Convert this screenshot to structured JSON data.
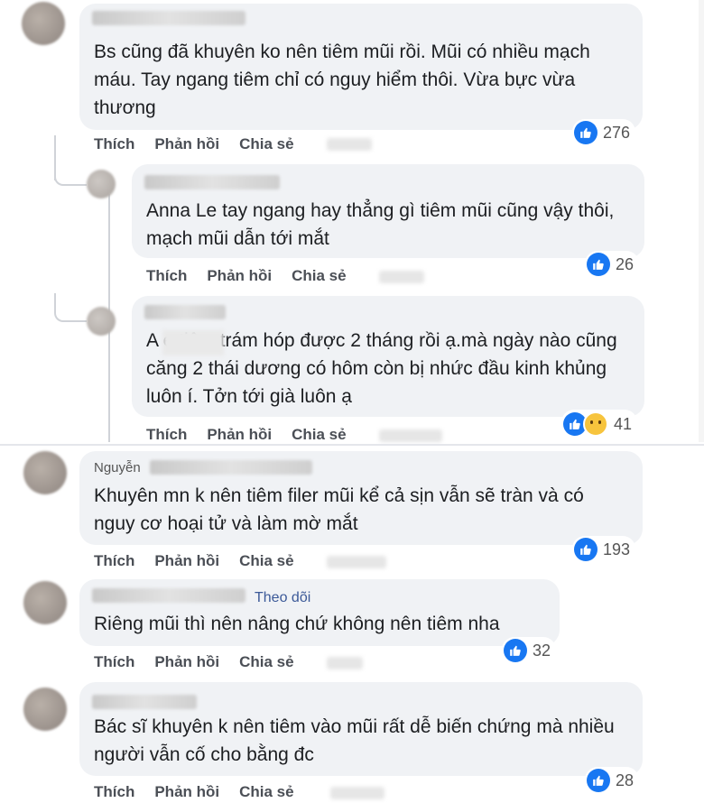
{
  "actions": {
    "like": "Thích",
    "reply": "Phản hồi",
    "share": "Chia sẻ"
  },
  "comments": [
    {
      "text": "Bs cũng đã khuyên ko nên tiêm mũi rồi. Mũi có nhiều mạch máu. Tay ngang tiêm chỉ có nguy hiểm thôi. Vừa bực vừa thương",
      "reactions": "276"
    },
    {
      "text": "Anna Le tay ngang hay thẳng gì tiêm mũi cũng vậy thôi, mạch mũi dẫn tới mắt",
      "reactions": "26"
    },
    {
      "text": "A e tiêm trám hóp được 2 tháng rồi ạ.mà ngày nào cũng căng 2 thái dương có hôm còn bị nhức đầu kinh khủng luôn í. Tởn tới già luôn ạ",
      "reactions": "41"
    },
    {
      "author": "Nguyễn",
      "text": "Khuyên mn k nên tiêm filer mũi kể cả sịn vẫn sẽ tràn và có nguy cơ hoại tử và làm mờ mắt",
      "reactions": "193"
    },
    {
      "follow": "Theo dõi",
      "text": "Riêng mũi thì nên nâng chứ không nên tiêm nha",
      "reactions": "32"
    },
    {
      "text": "Bác sĩ khuyên k nên tiêm vào mũi rất dễ biến chứng mà nhiều người vẫn cố cho bằng đc",
      "reactions": "28"
    }
  ],
  "colors": {
    "like": "#1877f2",
    "bubble": "#f0f2f5",
    "follow": "#3b5998"
  }
}
